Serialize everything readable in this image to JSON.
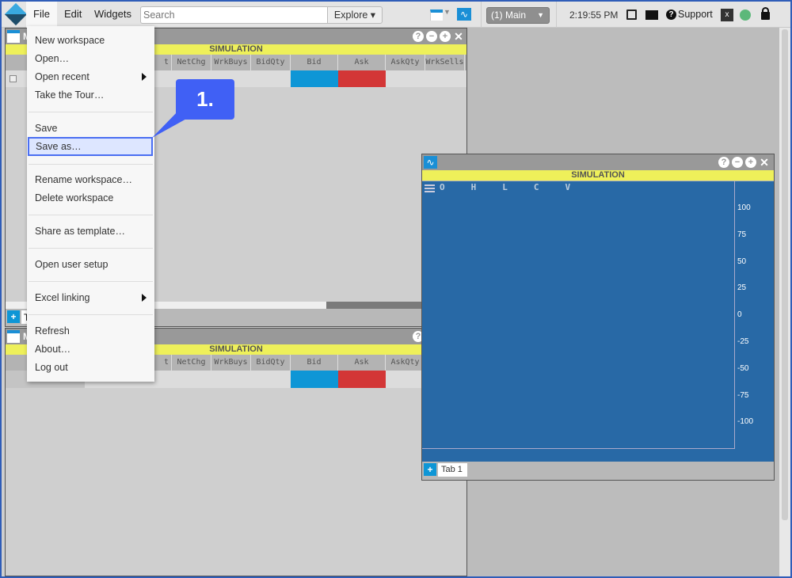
{
  "topbar": {
    "menus": [
      "File",
      "Edit",
      "Widgets"
    ],
    "search_placeholder": "Search",
    "explore_label": "Explore",
    "workspace_select": "(1) Main",
    "clock": "2:19:55 PM",
    "support_label": "Support",
    "status_color": "#5cb87a"
  },
  "file_menu": {
    "items": [
      "New workspace",
      "Open…",
      "Open recent",
      "Take the Tour…",
      "Save",
      "Save as…",
      "Rename workspace…",
      "Delete workspace",
      "Share as template…",
      "Open user setup",
      "Excel linking",
      "Refresh",
      "About…",
      "Log out"
    ],
    "highlighted": "Save as…"
  },
  "callout": {
    "label": "1."
  },
  "grid_window_1": {
    "title": "M",
    "banner": "SIMULATION",
    "columns": [
      "t",
      "NetChg",
      "WrkBuys",
      "BidQty",
      "Bid",
      "Ask",
      "AskQty",
      "WrkSells"
    ],
    "tab": "T"
  },
  "grid_window_2": {
    "title": "M",
    "banner": "SIMULATION",
    "columns": [
      "t",
      "NetChg",
      "WrkBuys",
      "BidQty",
      "Bid",
      "Ask",
      "AskQty"
    ]
  },
  "chart_window": {
    "banner": "SIMULATION",
    "ohlcv": [
      "O",
      "H",
      "L",
      "C",
      "V"
    ],
    "y_ticks": [
      "100",
      "75",
      "50",
      "25",
      "0",
      "-25",
      "-50",
      "-75",
      "-100"
    ],
    "tab": "Tab 1"
  },
  "colors": {
    "bid": "#0e96d6",
    "ask": "#d33636",
    "chart_bg": "#2869a6",
    "banner": "#eef05a",
    "callout": "#4060f5"
  }
}
